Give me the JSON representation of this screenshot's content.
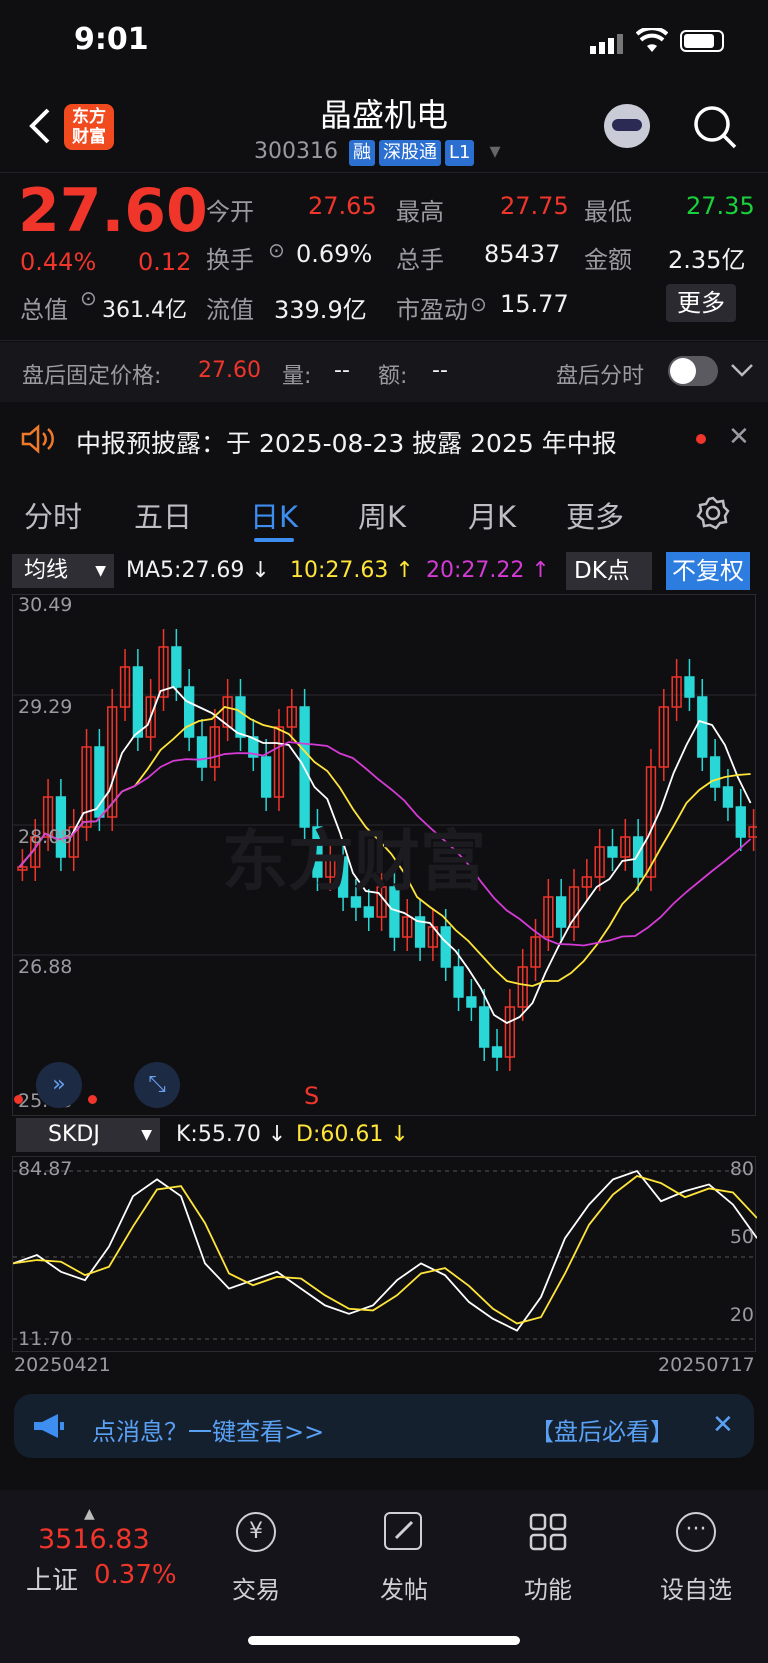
{
  "status_bar": {
    "time": "9:01"
  },
  "header": {
    "logo_text": "东方\n财富",
    "stock_name": "晶盛机电",
    "stock_code": "300316",
    "tags": [
      "融",
      "深股通",
      "L1"
    ]
  },
  "quote": {
    "price": "27.60",
    "change_pct": "0.44%",
    "change": "0.12",
    "stats": [
      {
        "label": "今开",
        "value": "27.65",
        "color": "#f0352b"
      },
      {
        "label": "最高",
        "value": "27.75",
        "color": "#f0352b"
      },
      {
        "label": "最低",
        "value": "27.35",
        "color": "#19d13a"
      },
      {
        "label": "换手",
        "value": "0.69%",
        "color": "#f1f1f1"
      },
      {
        "label": "总手",
        "value": "85437",
        "color": "#f1f1f1"
      },
      {
        "label": "金额",
        "value": "2.35亿",
        "color": "#f1f1f1"
      },
      {
        "label": "总值",
        "value": "361.4亿",
        "color": "#f1f1f1"
      },
      {
        "label": "流值",
        "value": "339.9亿",
        "color": "#f1f1f1"
      },
      {
        "label": "市盈动",
        "value": "15.77",
        "color": "#f1f1f1"
      }
    ],
    "more_label": "更多"
  },
  "after_hours": {
    "label": "盘后固定价格:",
    "price": "27.60",
    "vol_label": "量:",
    "vol": "--",
    "amt_label": "额:",
    "amt": "--",
    "intraday_label": "盘后分时"
  },
  "notice": {
    "text": "中报预披露：于 2025-08-23 披露 2025 年中报"
  },
  "tabs": [
    "分时",
    "五日",
    "日K",
    "周K",
    "月K",
    "更多"
  ],
  "active_tab": "日K",
  "ma_bar": {
    "select": "均线",
    "ma5": "MA5:27.69",
    "ma10": "10:27.63",
    "ma20": "20:27.22",
    "dk": "DK点",
    "adjust": "不复权"
  },
  "kline": {
    "y_labels": [
      "30.49",
      "29.29",
      "28.08",
      "26.88",
      "25.68"
    ],
    "s_marker": "S",
    "watermark": "东方财富"
  },
  "skdj_bar": {
    "select": "SKDJ",
    "k": "K:55.70",
    "d": "D:60.61"
  },
  "skdj": {
    "y_left": [
      "84.87",
      "11.70"
    ],
    "y_right": [
      "80",
      "50",
      "20"
    ],
    "date_start": "20250421",
    "date_end": "20250717"
  },
  "chart_data": {
    "type": "line",
    "title": "",
    "xlabel": "",
    "ylabel": "",
    "ylim": [
      25.68,
      30.49
    ],
    "x": [
      "20250421",
      "20250717"
    ],
    "series": [
      {
        "name": "MA5",
        "last": 27.69,
        "color": "#ffffff"
      },
      {
        "name": "10",
        "last": 27.63,
        "color": "#ffe53a"
      },
      {
        "name": "20",
        "last": 27.22,
        "color": "#d43bd4"
      }
    ]
  },
  "banner": {
    "text": "点消息？一键查看>>",
    "tag": "【盘后必看】"
  },
  "bottom_nav": {
    "index_value": "3516.83",
    "index_name": "上证",
    "index_pct": "0.37%",
    "items": [
      "交易",
      "发帖",
      "功能",
      "设自选"
    ]
  }
}
